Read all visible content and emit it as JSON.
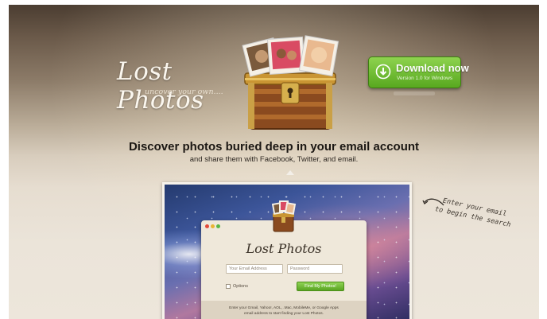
{
  "logo": {
    "title": "Lost Photos",
    "tagline": "uncover your own...."
  },
  "download": {
    "label": "Download now",
    "sublabel": "Version 1.0 for Windows",
    "color": "#6cbd32"
  },
  "hero": {
    "headline": "Discover photos buried deep in your email account",
    "subline": "and share them with Facebook, Twitter, and email."
  },
  "app_window": {
    "title": "Lost Photos",
    "email_placeholder": "Your Email Address",
    "password_placeholder": "Password",
    "options_label": "Options",
    "find_button": "Find My Photos!",
    "footer_line1": "Enter your Gmail, Yahoo!, AOL, .Mac, MobileMe, or Google Apps",
    "footer_line2": "email address to start finding your Lost Photos."
  },
  "annotation": {
    "line1": "Enter your email",
    "line2": "to begin the search"
  },
  "icons": [
    "download-arrow-icon",
    "treasure-chest-icon",
    "close-dot-icon",
    "minimize-dot-icon",
    "zoom-dot-icon",
    "curved-arrow-icon"
  ]
}
